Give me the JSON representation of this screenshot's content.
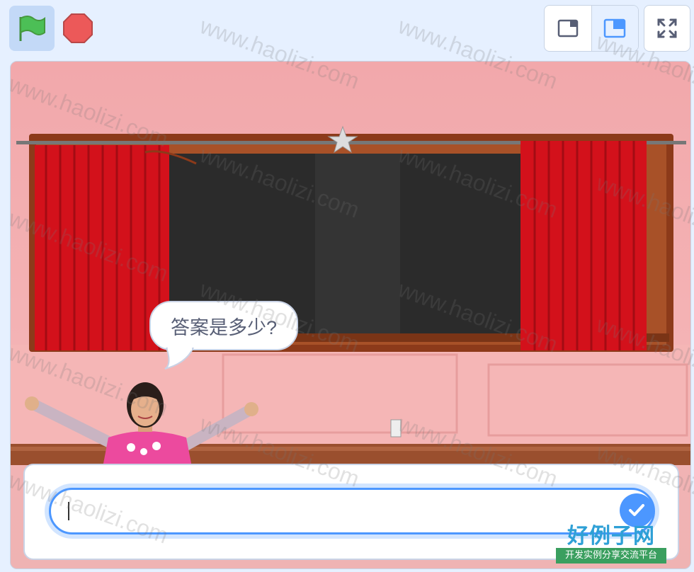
{
  "toolbar": {
    "green_flag_icon": "green-flag-icon",
    "stop_icon": "stop-sign-icon",
    "small_stage_icon": "small-stage-icon",
    "normal_stage_icon": "normal-stage-icon",
    "fullscreen_icon": "fullscreen-icon",
    "selected_mode": "normal-stage"
  },
  "stage": {
    "speech_bubble": "答案是多少?",
    "answer_input_value": "",
    "submit_icon": "check-icon"
  },
  "watermark": {
    "text": "www.haolizi.com",
    "logo_title": "好例子网",
    "logo_subtitle": "开发实例分享交流平台"
  },
  "colors": {
    "accent": "#4c97ff",
    "flag_green": "#4cbf56",
    "stop_red": "#ec5959",
    "curtain_red": "#d3111b",
    "wall_pink": "#f2a8ab"
  }
}
